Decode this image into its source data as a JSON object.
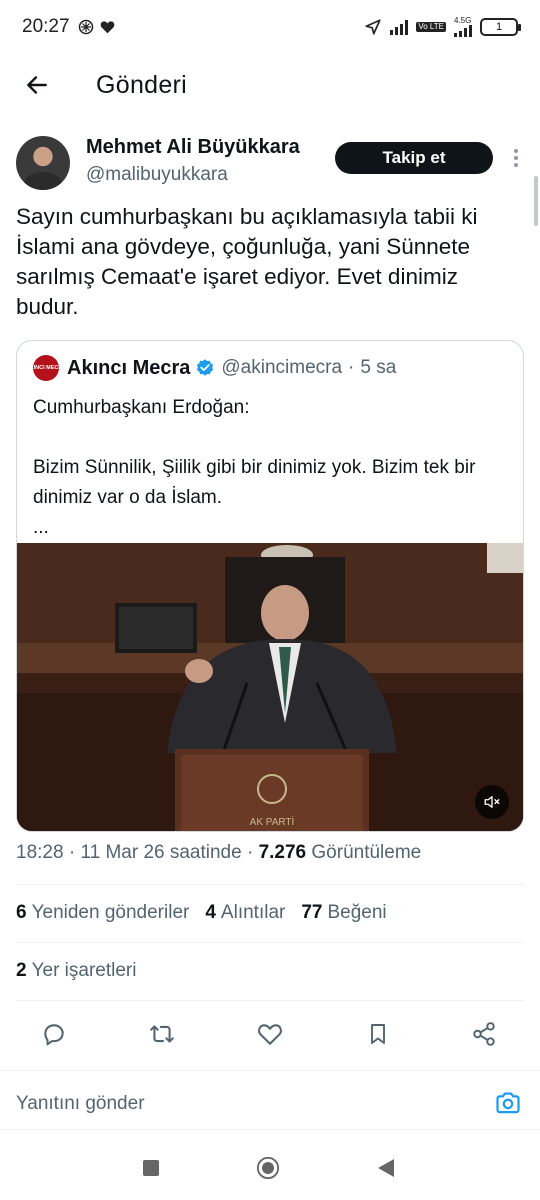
{
  "status_bar": {
    "time": "20:27",
    "network": "4.5G",
    "volte": "Vo LTE",
    "battery": "1"
  },
  "header": {
    "title": "Gönderi"
  },
  "post": {
    "author_name": "Mehmet Ali Büyükkara",
    "author_handle": "@malibuyukkara",
    "follow_label": "Takip et",
    "text": "Sayın cumhurbaşkanı bu açıklamasıyla tabii ki İslami ana gövdeye, çoğunluğa, yani Sünnete sarılmış Cemaat'e işaret ediyor. Evet dinimiz budur."
  },
  "quote": {
    "avatar_text": "AKINCI MECRA",
    "name": "Akıncı Mecra",
    "handle": "@akincimecra",
    "sep": "·",
    "time": "5 sa",
    "line1": "Cumhurbaşkanı Erdoğan:",
    "line2": "Bizim Sünnilik, Şiilik gibi bir dinimiz yok. Bizim tek bir dinimiz var o da İslam.",
    "line3": "...",
    "media_caption": "AK PARTİ"
  },
  "meta": {
    "time": "18:28",
    "sep1": "·",
    "date": "11 Mar 26 saatinde",
    "sep2": "·",
    "views": "7.276",
    "views_label": "Görüntüleme"
  },
  "stats": {
    "retweets": "6",
    "retweets_label": "Yeniden gönderiler",
    "quotes": "4",
    "quotes_label": "Alıntılar",
    "likes": "77",
    "likes_label": "Beğeni",
    "bookmarks": "2",
    "bookmarks_label": "Yer işaretleri"
  },
  "reply": {
    "placeholder": "Yanıtını gönder"
  },
  "colors": {
    "accent": "#1d9bf0",
    "text": "#0f1419",
    "muted": "#536471",
    "border": "#cfd9de"
  },
  "icons": [
    "arrow-back-icon",
    "more-vertical-icon",
    "verified-badge-icon",
    "mute-icon",
    "reply-icon",
    "retweet-icon",
    "like-icon",
    "bookmark-icon",
    "share-icon",
    "camera-icon",
    "nav-recents-icon",
    "nav-home-icon",
    "nav-back-icon"
  ]
}
